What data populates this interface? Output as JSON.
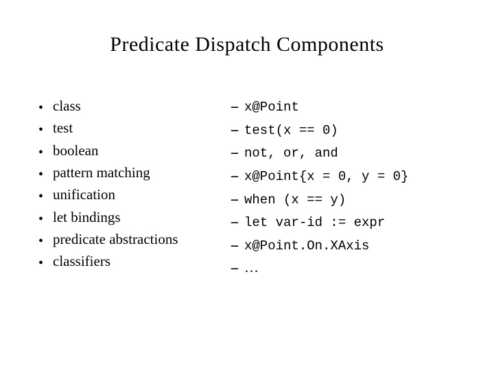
{
  "title": "Predicate Dispatch Components",
  "left": {
    "items": [
      "class",
      "test",
      "boolean",
      "pattern matching",
      "unification",
      "let bindings",
      "predicate abstractions",
      "classifiers"
    ]
  },
  "right": {
    "examples": [
      "x@Point",
      "test(x == 0)",
      "not, or, and",
      "x@Point{x = 0, y = 0}",
      "when (x == y)",
      "let var-id := expr",
      "x@Point.On.XAxis",
      "…"
    ]
  },
  "bullet_glyph": "•",
  "dash_glyph": "--"
}
